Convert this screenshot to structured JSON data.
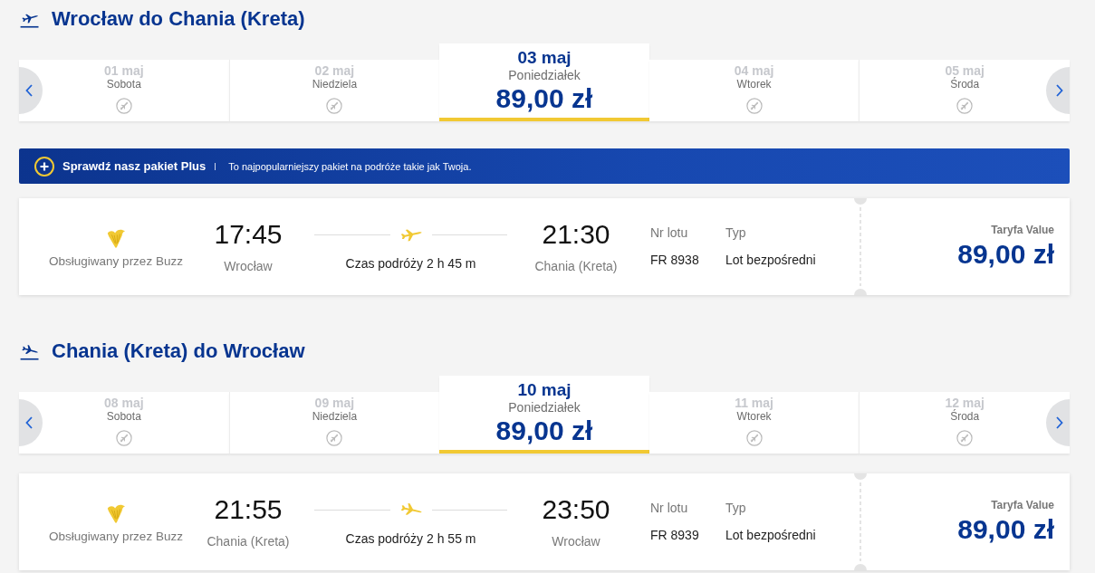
{
  "sections": [
    {
      "kind": "outbound",
      "title": "Wrocław do Chania (Kreta)",
      "dates": [
        {
          "date": "01 maj",
          "day": "Sobota",
          "available": false,
          "selected": false
        },
        {
          "date": "02 maj",
          "day": "Niedziela",
          "available": false,
          "selected": false
        },
        {
          "date": "03 maj",
          "day": "Poniedziałek",
          "price": "89,00 zł",
          "available": true,
          "selected": true
        },
        {
          "date": "04 maj",
          "day": "Wtorek",
          "available": false,
          "selected": false
        },
        {
          "date": "05 maj",
          "day": "Środa",
          "available": false,
          "selected": false
        }
      ],
      "promo": {
        "title": "Sprawdź nasz pakiet Plus",
        "text": "To najpopularniejszy pakiet na podróże takie jak Twoja."
      },
      "flight": {
        "operator": "Obsługiwany przez Buzz",
        "departure": {
          "time": "17:45",
          "city": "Wrocław"
        },
        "duration": "Czas podróży 2 h 45 m",
        "arrival": {
          "time": "21:30",
          "city": "Chania (Kreta)"
        },
        "flight_number": {
          "label": "Nr lotu",
          "value": "FR 8938"
        },
        "flight_type": {
          "label": "Typ",
          "value": "Lot bezpośredni"
        },
        "fare": {
          "label": "Taryfa Value",
          "price": "89,00 zł"
        }
      }
    },
    {
      "kind": "return",
      "title": "Chania (Kreta) do Wrocław",
      "dates": [
        {
          "date": "08 maj",
          "day": "Sobota",
          "available": false,
          "selected": false
        },
        {
          "date": "09 maj",
          "day": "Niedziela",
          "available": false,
          "selected": false
        },
        {
          "date": "10 maj",
          "day": "Poniedziałek",
          "price": "89,00 zł",
          "available": true,
          "selected": true
        },
        {
          "date": "11 maj",
          "day": "Wtorek",
          "available": false,
          "selected": false
        },
        {
          "date": "12 maj",
          "day": "Środa",
          "available": false,
          "selected": false
        }
      ],
      "flight": {
        "operator": "Obsługiwany przez Buzz",
        "departure": {
          "time": "21:55",
          "city": "Chania (Kreta)"
        },
        "duration": "Czas podróży 2 h 55 m",
        "arrival": {
          "time": "23:50",
          "city": "Wrocław"
        },
        "flight_number": {
          "label": "Nr lotu",
          "value": "FR 8939"
        },
        "flight_type": {
          "label": "Typ",
          "value": "Lot bezpośredni"
        },
        "fare": {
          "label": "Taryfa Value",
          "price": "89,00 zł"
        }
      }
    }
  ]
}
